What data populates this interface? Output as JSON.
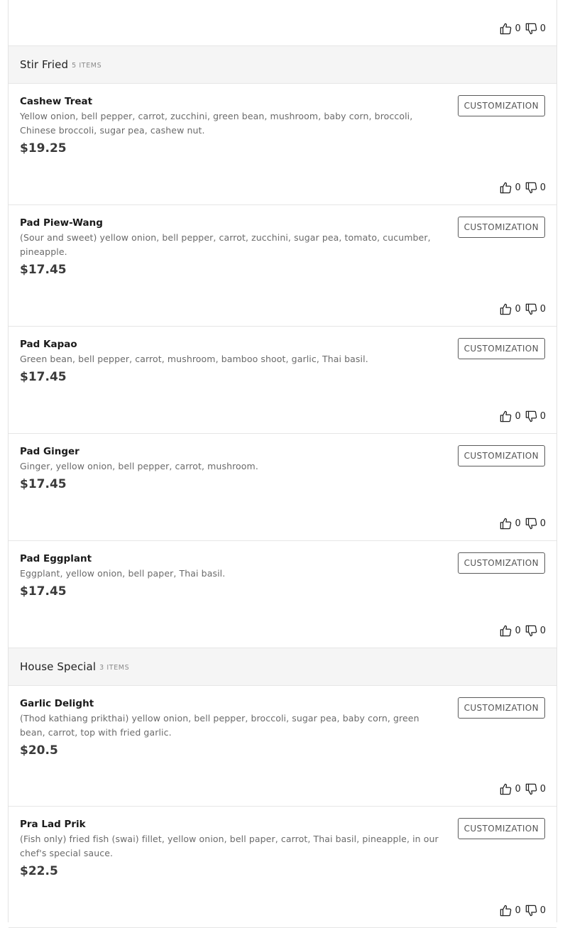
{
  "top_item": {
    "likes": "0",
    "dislikes": "0"
  },
  "sections": [
    {
      "title": "Stir Fried",
      "count": "5 ITEMS",
      "items": [
        {
          "name": "Cashew Treat",
          "desc": "Yellow onion, bell pepper, carrot, zucchini, green bean, mushroom, baby corn, broccoli, Chinese broccoli, sugar pea, cashew nut.",
          "price": "$19.25",
          "button": "CUSTOMIZATION",
          "likes": "0",
          "dislikes": "0"
        },
        {
          "name": "Pad Piew-Wang",
          "desc": "(Sour and sweet) yellow onion, bell pepper, carrot, zucchini, sugar pea, tomato, cucumber, pineapple.",
          "price": "$17.45",
          "button": "CUSTOMIZATION",
          "likes": "0",
          "dislikes": "0"
        },
        {
          "name": "Pad Kapao",
          "desc": "Green bean, bell pepper, carrot, mushroom, bamboo shoot, garlic, Thai basil.",
          "price": "$17.45",
          "button": "CUSTOMIZATION",
          "likes": "0",
          "dislikes": "0"
        },
        {
          "name": "Pad Ginger",
          "desc": "Ginger, yellow onion, bell pepper, carrot, mushroom.",
          "price": "$17.45",
          "button": "CUSTOMIZATION",
          "likes": "0",
          "dislikes": "0"
        },
        {
          "name": "Pad Eggplant",
          "desc": "Eggplant, yellow onion, bell paper, Thai basil.",
          "price": "$17.45",
          "button": "CUSTOMIZATION",
          "likes": "0",
          "dislikes": "0"
        }
      ]
    },
    {
      "title": "House Special",
      "count": "3 ITEMS",
      "items": [
        {
          "name": "Garlic Delight",
          "desc": "(Thod kathiang prikthai) yellow onion, bell pepper, broccoli, sugar pea, baby corn, green bean, carrot, top with fried garlic.",
          "price": "$20.5",
          "button": "CUSTOMIZATION",
          "likes": "0",
          "dislikes": "0"
        },
        {
          "name": "Pra Lad Prik",
          "desc": "(Fish only) fried fish (swai) fillet, yellow onion, bell paper, carrot, Thai basil, pineapple, in our chef's special sauce.",
          "price": "$22.5",
          "button": "CUSTOMIZATION",
          "likes": "0",
          "dislikes": "0"
        }
      ]
    }
  ],
  "icons": {
    "like": "thumbs-up-icon",
    "dislike": "thumbs-down-icon"
  }
}
